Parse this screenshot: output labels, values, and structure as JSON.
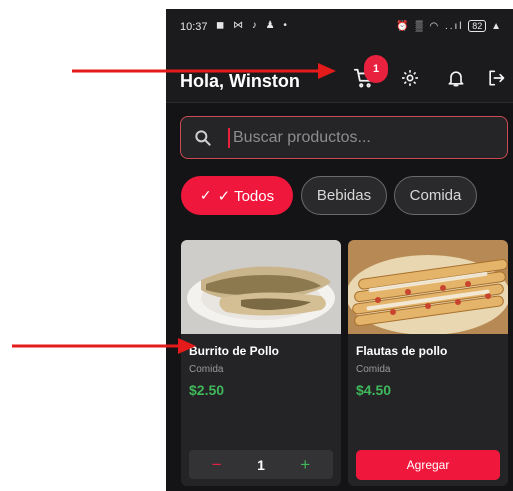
{
  "status_bar": {
    "time": "10:37",
    "left_icons": "◼ ⋈ ♪ ♟ •",
    "right_icons": "⏰ ▒ ◠ ..ıl",
    "battery": "82",
    "extra_icon": "▲"
  },
  "header": {
    "greeting": "Hola, Winston",
    "cart_count": "1",
    "icons": [
      "cart-icon",
      "gear-icon",
      "bell-icon",
      "logout-icon"
    ]
  },
  "search": {
    "placeholder": "Buscar productos..."
  },
  "categories": [
    {
      "label": "✓ Todos",
      "active": true
    },
    {
      "label": "Bebidas",
      "active": false
    },
    {
      "label": "Comida",
      "active": false
    }
  ],
  "products": [
    {
      "name": "Burrito de Pollo",
      "category": "Comida",
      "price": "$2.50",
      "quantity": "1",
      "minus": "−",
      "plus": "+"
    },
    {
      "name": "Flautas de pollo",
      "category": "Comida",
      "price": "$4.50",
      "action": "Agregar"
    }
  ],
  "colors": {
    "accent": "#f0173d",
    "price_green": "#3fb75a",
    "background": "#141416",
    "card": "#242426"
  }
}
